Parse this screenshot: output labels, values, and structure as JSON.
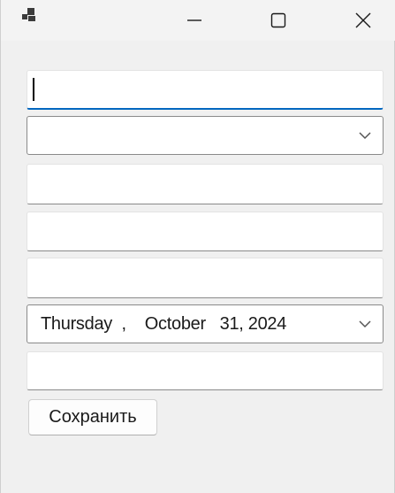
{
  "window": {
    "icon": "app-icon",
    "controls": {
      "minimize_icon": "minimize-icon",
      "maximize_icon": "maximize-icon",
      "close_icon": "close-icon"
    }
  },
  "form": {
    "field1": {
      "value": "",
      "placeholder": ""
    },
    "combo1": {
      "value": "",
      "icon": "chevron-down-icon"
    },
    "field2": {
      "value": "",
      "placeholder": ""
    },
    "field3": {
      "value": "",
      "placeholder": ""
    },
    "field4": {
      "value": "",
      "placeholder": ""
    },
    "date": {
      "weekday": "Thursday",
      "sep": ",",
      "month": "October",
      "day_year": "31, 2024",
      "icon": "chevron-down-icon"
    },
    "field5": {
      "value": "",
      "placeholder": ""
    },
    "save_label": "Сохранить"
  },
  "colors": {
    "accent": "#0067c0",
    "background": "#f0f0f0",
    "titlebar": "#f3f3f3"
  }
}
